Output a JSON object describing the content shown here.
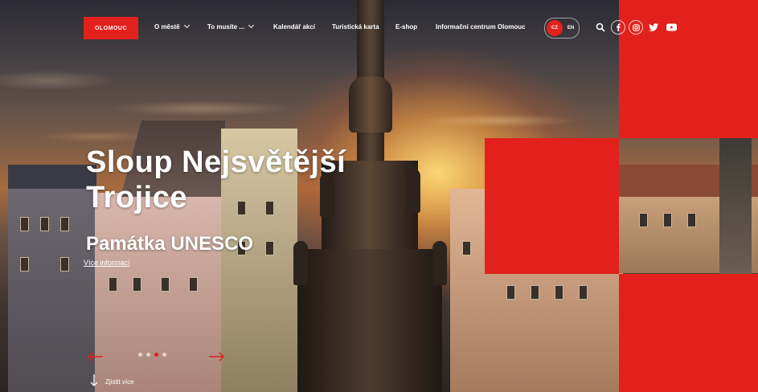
{
  "brand": {
    "logo_text": "OLOMOUC",
    "accent": "#e2211c"
  },
  "nav": {
    "items": [
      {
        "label": "O městě",
        "dropdown": true
      },
      {
        "label": "To musíte ...",
        "dropdown": true
      },
      {
        "label": "Kalendář akcí",
        "dropdown": false
      },
      {
        "label": "Turistická karta",
        "dropdown": false
      },
      {
        "label": "E-shop",
        "dropdown": false
      },
      {
        "label": "Informační centrum Olomouc",
        "dropdown": false
      }
    ],
    "languages": {
      "active": "CZ",
      "other": "EN"
    },
    "icons": [
      "search-icon",
      "facebook-icon",
      "instagram-icon",
      "twitter-icon",
      "youtube-icon"
    ]
  },
  "hero": {
    "title_line1": "Sloup Nejsvětější",
    "title_line2": "Trojice",
    "subtitle": "Památka UNESCO",
    "more_link": "Více informací",
    "slides": {
      "count": 4,
      "active": 2
    },
    "scroll_label": "Zjistit více"
  }
}
